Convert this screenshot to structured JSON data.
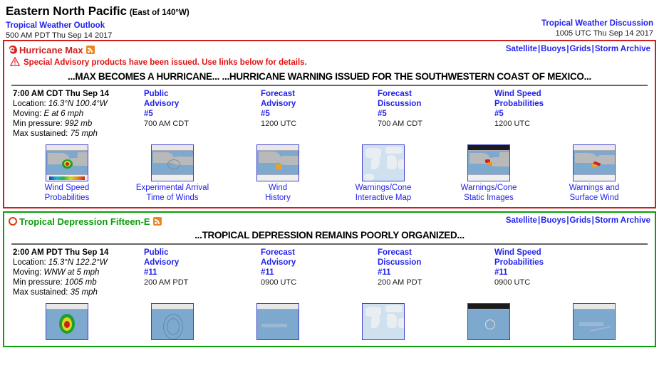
{
  "header": {
    "basin_title": "Eastern North Pacific",
    "basin_sub": "(East of 140°W)",
    "outlook_link": "Tropical Weather Outlook",
    "outlook_time": "500 AM PDT Thu Sep 14 2017",
    "discussion_link": "Tropical Weather Discussion",
    "discussion_time": "1005 UTC Thu Sep 14 2017"
  },
  "quicklinks": {
    "satellite": "Satellite",
    "buoys": "Buoys",
    "grids": "Grids",
    "storm_archive": "Storm Archive",
    "separator": "|"
  },
  "storms": [
    {
      "name": "Hurricane Max",
      "icon": "hurricane-icon",
      "rss": "rss-icon",
      "border_color": "#cc2020",
      "name_color": "#cc2020",
      "special_advisory": "Special Advisory products have been issued.   Use links below for details.",
      "headline": "...MAX BECOMES A HURRICANE... ...HURRICANE WARNING ISSUED FOR THE SOUTHWESTERN COAST OF MEXICO...",
      "stats": {
        "time": "7:00 AM CDT Thu Sep 14",
        "location_label": "Location:",
        "location_value": "16.3°N 100.4°W",
        "moving_label": "Moving:",
        "moving_value": "E at 6 mph",
        "pressure_label": "Min pressure:",
        "pressure_value": "992 mb",
        "wind_label": "Max sustained:",
        "wind_value": "75 mph"
      },
      "products": [
        {
          "line1": "Public",
          "line2": "Advisory",
          "number": "#5",
          "time": "700 AM CDT"
        },
        {
          "line1": "Forecast",
          "line2": "Advisory",
          "number": "#5",
          "time": "1200 UTC"
        },
        {
          "line1": "Forecast",
          "line2": "Discussion",
          "number": "#5",
          "time": "700 AM CDT"
        },
        {
          "line1": "Wind Speed",
          "line2": "Probabilities",
          "number": "#5",
          "time": "1200 UTC"
        }
      ],
      "thumbnails": [
        {
          "line1": "Wind Speed",
          "line2": "Probabilities",
          "kind": "wsp"
        },
        {
          "line1": "Experimental Arrival",
          "line2": "Time of Winds",
          "kind": "arrival"
        },
        {
          "line1": "Wind",
          "line2": "History",
          "kind": "windhistory"
        },
        {
          "line1": "Warnings/Cone",
          "line2": "Interactive Map",
          "kind": "world"
        },
        {
          "line1": "Warnings/Cone",
          "line2": "Static Images",
          "kind": "conestatic"
        },
        {
          "line1": "Warnings and",
          "line2": "Surface Wind",
          "kind": "surfacewind"
        }
      ]
    },
    {
      "name": "Tropical Depression Fifteen-E",
      "icon": "circle-icon",
      "rss": "rss-icon",
      "border_color": "#0a9e0a",
      "name_color": "#0a9e0a",
      "special_advisory": null,
      "headline": "...TROPICAL DEPRESSION REMAINS POORLY ORGANIZED...",
      "stats": {
        "time": "2:00 AM PDT Thu Sep 14",
        "location_label": "Location:",
        "location_value": "15.3°N 122.2°W",
        "moving_label": "Moving:",
        "moving_value": "WNW at 5 mph",
        "pressure_label": "Min pressure:",
        "pressure_value": "1005 mb",
        "wind_label": "Max sustained:",
        "wind_value": "35 mph"
      },
      "products": [
        {
          "line1": "Public",
          "line2": "Advisory",
          "number": "#11",
          "time": "200 AM PDT"
        },
        {
          "line1": "Forecast",
          "line2": "Advisory",
          "number": "#11",
          "time": "0900 UTC"
        },
        {
          "line1": "Forecast",
          "line2": "Discussion",
          "number": "#11",
          "time": "200 AM PDT"
        },
        {
          "line1": "Wind Speed",
          "line2": "Probabilities",
          "number": "#11",
          "time": "0900 UTC"
        }
      ],
      "thumbnails": [
        {
          "line1": "",
          "line2": "",
          "kind": "wsp2"
        },
        {
          "line1": "",
          "line2": "",
          "kind": "arrival2"
        },
        {
          "line1": "",
          "line2": "",
          "kind": "windhistory2"
        },
        {
          "line1": "",
          "line2": "",
          "kind": "world"
        },
        {
          "line1": "",
          "line2": "",
          "kind": "conestatic2"
        },
        {
          "line1": "",
          "line2": "",
          "kind": "surfacewind2"
        }
      ]
    }
  ]
}
